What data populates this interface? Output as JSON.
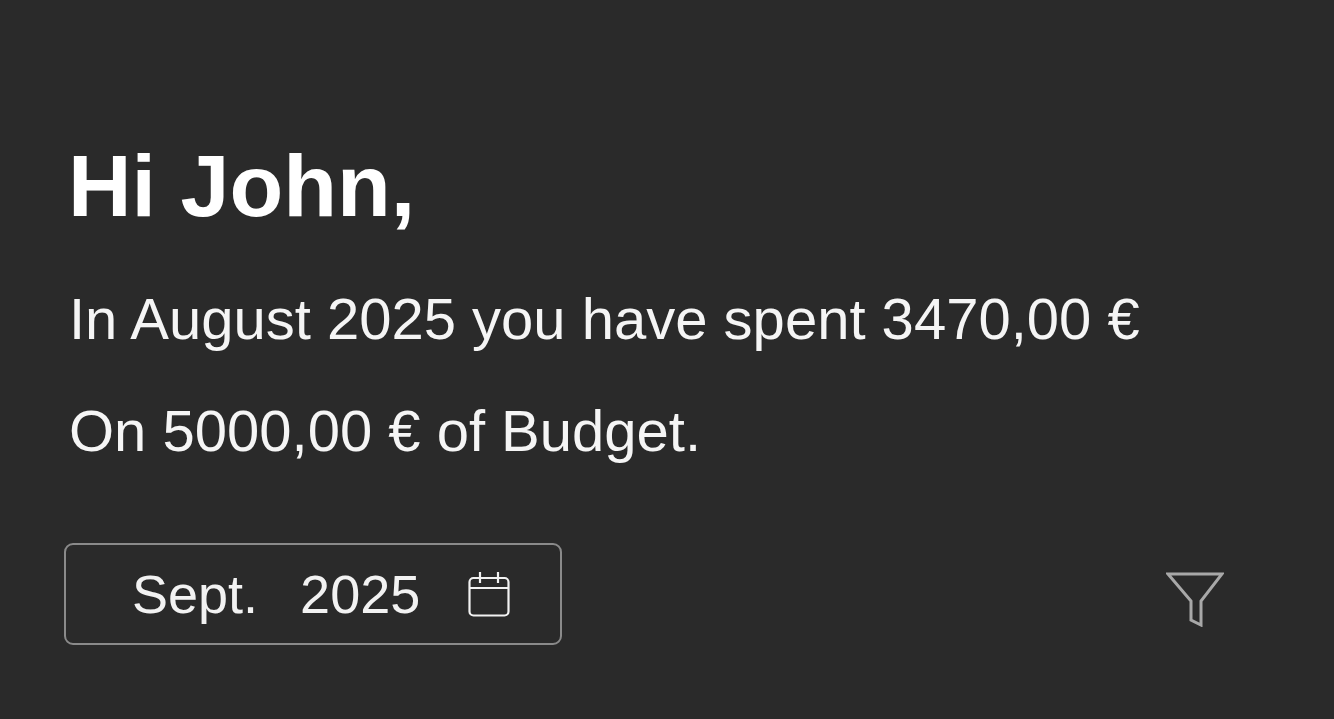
{
  "greeting": "Hi John,",
  "summary_lines": [
    "In August 2025 you have spent 3470,00 €",
    "On 5000,00 € of Budget."
  ],
  "date_picker": {
    "month": "Sept.",
    "year": "2025"
  }
}
